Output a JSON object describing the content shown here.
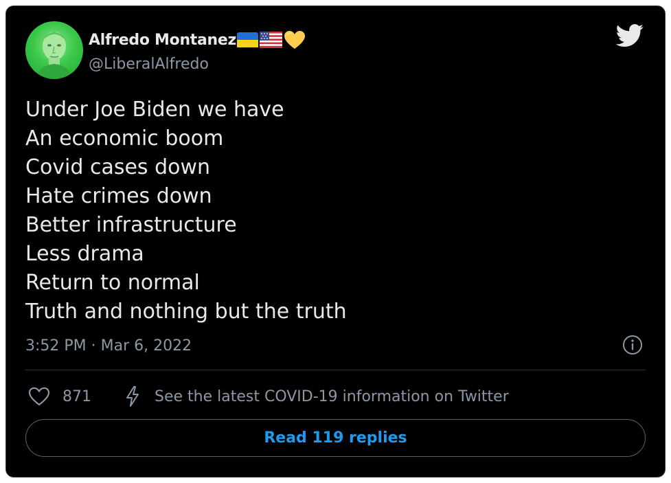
{
  "tweet": {
    "author": {
      "name": "Alfredo Montanez",
      "handle": "@LiberalAlfredo",
      "badges": [
        "ukraine-flag-icon",
        "us-flag-icon",
        "yellow-heart-icon"
      ]
    },
    "lines": [
      "Under Joe Biden we have",
      "An economic boom",
      "Covid cases down",
      "Hate crimes down",
      "Better infrastructure",
      "Less drama",
      "Return to normal",
      "Truth and nothing but the truth"
    ],
    "timestamp": "3:52 PM · Mar 6, 2022",
    "likes": "871",
    "covid_link": "See the latest COVID-19 information on Twitter",
    "replies_button": "Read 119 replies"
  },
  "colors": {
    "background": "#000000",
    "text": "#e7e9ea",
    "muted": "#8b98a5",
    "accent": "#1d9bf0",
    "avatar_bg": "#3cc94a"
  }
}
